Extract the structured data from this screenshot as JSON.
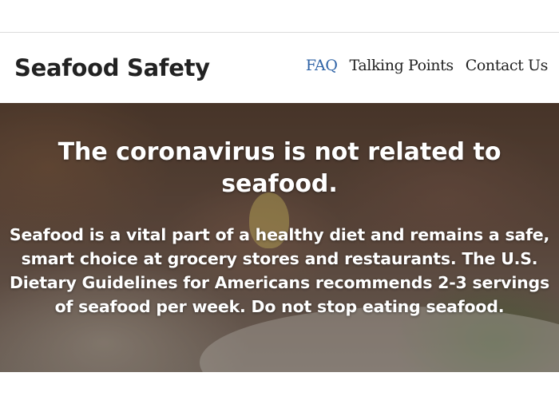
{
  "header": {
    "site_title": "Seafood Safety",
    "nav": {
      "faq": "FAQ",
      "talking_points": "Talking Points",
      "contact_us": "Contact Us"
    },
    "active_nav": "FAQ"
  },
  "hero": {
    "heading": "The coronavirus is not related to seafood.",
    "body": "Seafood is a vital part of a healthy diet and remains a safe, smart choice at grocery stores and restaurants. The U.S. Dietary Guidelines for Americans recommends 2-3 servings of seafood per week. Do not stop eating seafood."
  },
  "colors": {
    "nav_active": "#2f63a6",
    "text_dark": "#222222",
    "hero_text": "#ffffff"
  }
}
